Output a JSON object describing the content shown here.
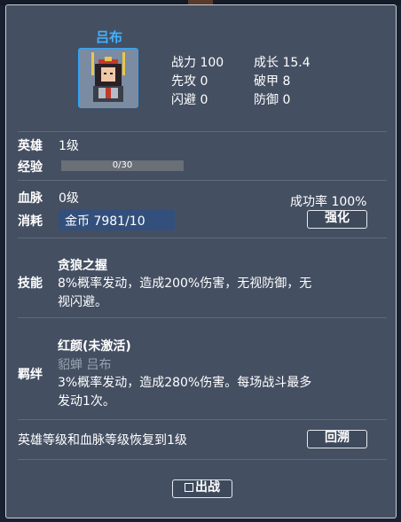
{
  "hero": {
    "name": "吕布",
    "icons": {
      "portrait": "hero-portrait-icon"
    }
  },
  "stats": {
    "power": "战力 100",
    "growth": "成长 15.4",
    "initiative": "先攻 0",
    "armor_break": "破甲 8",
    "dodge": "闪避 0",
    "defense": "防御 0"
  },
  "level": {
    "label": "英雄",
    "value": "1级"
  },
  "exp": {
    "label": "经验",
    "text": "0/30",
    "progress": 0
  },
  "bloodline": {
    "label": "血脉",
    "value": "0级",
    "success_rate": "成功率 100%"
  },
  "cost": {
    "label": "消耗",
    "value": "金币 7981/10"
  },
  "buttons": {
    "enhance": "强化",
    "revert": "回溯",
    "deploy": "出战"
  },
  "skill": {
    "label": "技能",
    "name": "贪狼之握",
    "desc_line1": "8%概率发动，造成200%伤害，无视防御，无",
    "desc_line2": "视闪避。"
  },
  "bond": {
    "label": "羁绊",
    "name": "红颜(未激活)",
    "members": "貂蝉 吕布",
    "desc_line1": "3%概率发动，造成280%伤害。每场战斗最多",
    "desc_line2": "发动1次。"
  },
  "revert": {
    "text": "英雄等级和血脉等级恢复到1级"
  },
  "colors": {
    "panel_bg": "#444f62",
    "name_blue": "#3fb2ff",
    "cost_bg": "#33507c",
    "muted": "#9aa2ae"
  }
}
